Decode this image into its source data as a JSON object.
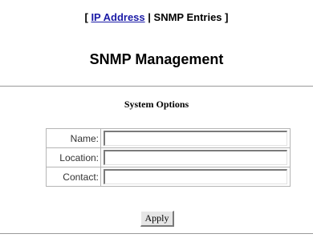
{
  "nav": {
    "open_bracket": "[",
    "ip_address_link": "IP Address",
    "separator": "|",
    "snmp_entries": "SNMP Entries",
    "close_bracket": "]"
  },
  "page_title": "SNMP Management",
  "section_title": "System Options",
  "form": {
    "name_label": "Name:",
    "name_value": "",
    "location_label": "Location:",
    "location_value": "",
    "contact_label": "Contact:",
    "contact_value": ""
  },
  "apply_label": "Apply"
}
